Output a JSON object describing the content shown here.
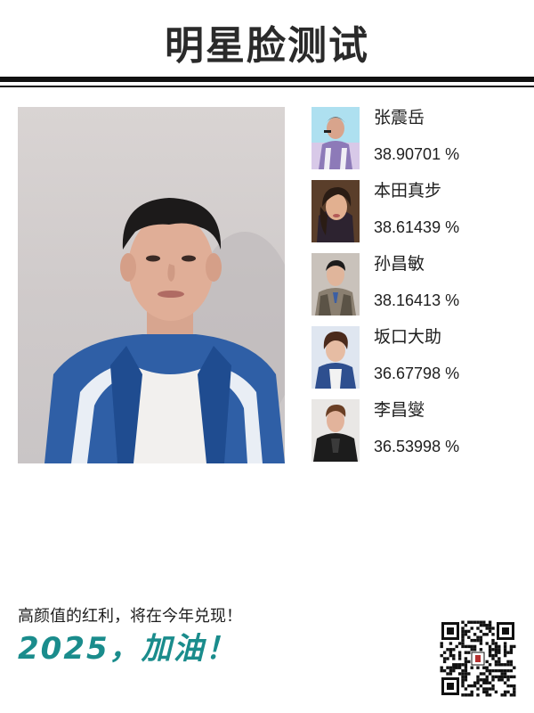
{
  "header": {
    "title": "明星脸测试"
  },
  "matches": [
    {
      "name": "张震岳",
      "score": "38.90701 %"
    },
    {
      "name": "本田真步",
      "score": "38.61439 %"
    },
    {
      "name": "孙昌敏",
      "score": "38.16413 %"
    },
    {
      "name": "坂口大助",
      "score": "36.67798 %"
    },
    {
      "name": "李昌燮",
      "score": "36.53998 %"
    }
  ],
  "footer": {
    "slogan": "高颜值的红利，将在今年兑现！",
    "cheer": "2025，加油！"
  },
  "colors": {
    "accent": "#1a8c8c",
    "rule": "#111111"
  },
  "icons": {
    "qr": "qr-code-icon"
  }
}
